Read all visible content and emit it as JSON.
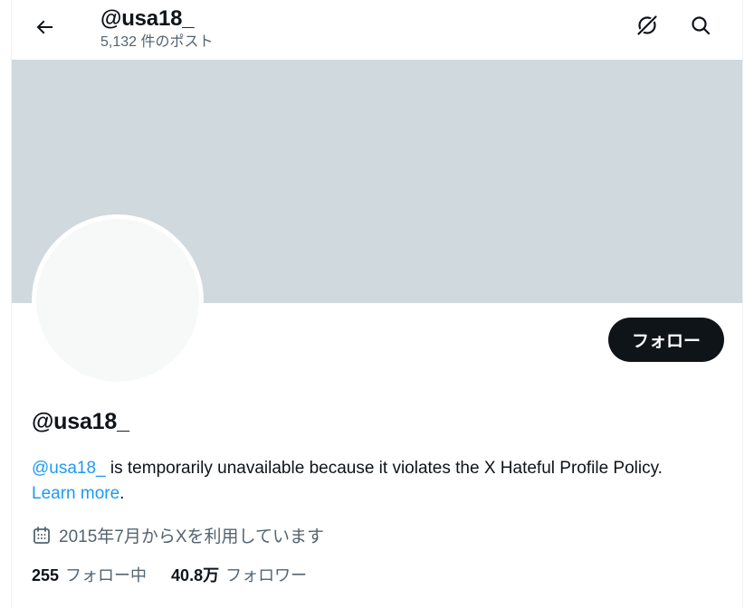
{
  "header": {
    "title": "@usa18_",
    "post_count": "5,132 件のポスト",
    "back_icon": "arrow-left-icon",
    "grok_icon": "grok-icon",
    "search_icon": "search-icon"
  },
  "profile": {
    "display_name": "@usa18_",
    "follow_label": "フォロー",
    "bio": {
      "handle_link": "@usa18_",
      "message": " is temporarily unavailable because it violates the X Hateful Profile Policy. ",
      "learn_more": "Learn more",
      "period": "."
    },
    "joined": "2015年7月からXを利用しています",
    "calendar_icon": "calendar-icon",
    "following": {
      "count": "255",
      "label": "フォロー中"
    },
    "followers": {
      "count": "40.8万",
      "label": "フォロワー"
    }
  },
  "colors": {
    "banner": "#cfd9de",
    "avatar": "#f7f9f9",
    "link": "#1d9bf0",
    "button": "#0f1419",
    "secondary_text": "#536471"
  }
}
